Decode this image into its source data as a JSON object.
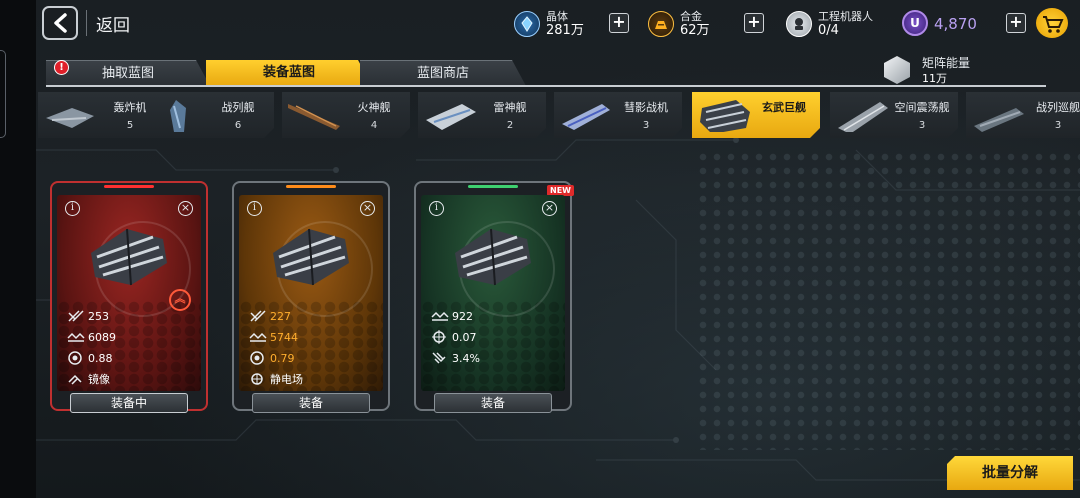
{
  "header": {
    "back_label": "返回",
    "resources": [
      {
        "name": "晶体",
        "value": "281万",
        "icon": "crystal-icon",
        "color": "#4ab0ff"
      },
      {
        "name": "合金",
        "value": "62万",
        "icon": "alloy-icon",
        "color": "#ffb020"
      },
      {
        "name": "工程机器人",
        "value": "0/4",
        "icon": "robot-icon",
        "color": "#d8dce0"
      }
    ],
    "premium": {
      "symbol": "U",
      "value": "4,870",
      "color": "#9a70e8"
    },
    "cart_icon": "cart-icon"
  },
  "tabs": [
    {
      "label": "抽取蓝图",
      "active": false,
      "badge": "!"
    },
    {
      "label": "装备蓝图",
      "active": true
    },
    {
      "label": "蓝图商店",
      "active": false
    }
  ],
  "matrix_energy": {
    "name": "矩阵能量",
    "value": "11万"
  },
  "categories": [
    {
      "name": "轰炸机",
      "count": "5"
    },
    {
      "name": "战列舰",
      "count": "6"
    },
    {
      "name": "火神舰",
      "count": "4"
    },
    {
      "name": "雷神舰",
      "count": "2"
    },
    {
      "name": "彗影战机",
      "count": "3"
    },
    {
      "name": "玄武巨舰",
      "count": "",
      "active": true
    },
    {
      "name": "空间震荡舰",
      "count": "3"
    },
    {
      "name": "战列巡舰",
      "count": "3"
    }
  ],
  "cards": [
    {
      "rarity": "red",
      "rarity_color": "#ff3030",
      "info_symbol": "i",
      "close_symbol": "×",
      "rank_symbol": "︽",
      "stats": [
        {
          "icon": "attack-icon",
          "value": "253"
        },
        {
          "icon": "armor-icon",
          "value": "6089"
        },
        {
          "icon": "shield-icon",
          "value": "0.88"
        },
        {
          "icon": "skill-icon",
          "value": "镜像"
        }
      ],
      "action": "装备中"
    },
    {
      "rarity": "orange",
      "rarity_color": "#ff8c1a",
      "info_symbol": "i",
      "close_symbol": "×",
      "stats": [
        {
          "icon": "attack-icon",
          "value": "227"
        },
        {
          "icon": "armor-icon",
          "value": "5744"
        },
        {
          "icon": "shield-icon",
          "value": "0.79"
        },
        {
          "icon": "skill-icon",
          "value": "静电场"
        }
      ],
      "action": "装备"
    },
    {
      "rarity": "green",
      "rarity_color": "#3ed070",
      "info_symbol": "i",
      "close_symbol": "×",
      "new_badge": "NEW",
      "stats": [
        {
          "icon": "armor-icon",
          "value": "922"
        },
        {
          "icon": "crosshair-icon",
          "value": "0.07"
        },
        {
          "icon": "damage-icon",
          "value": "3.4%"
        }
      ],
      "action": "装备"
    }
  ],
  "footer": {
    "batch_label": "批量分解"
  }
}
